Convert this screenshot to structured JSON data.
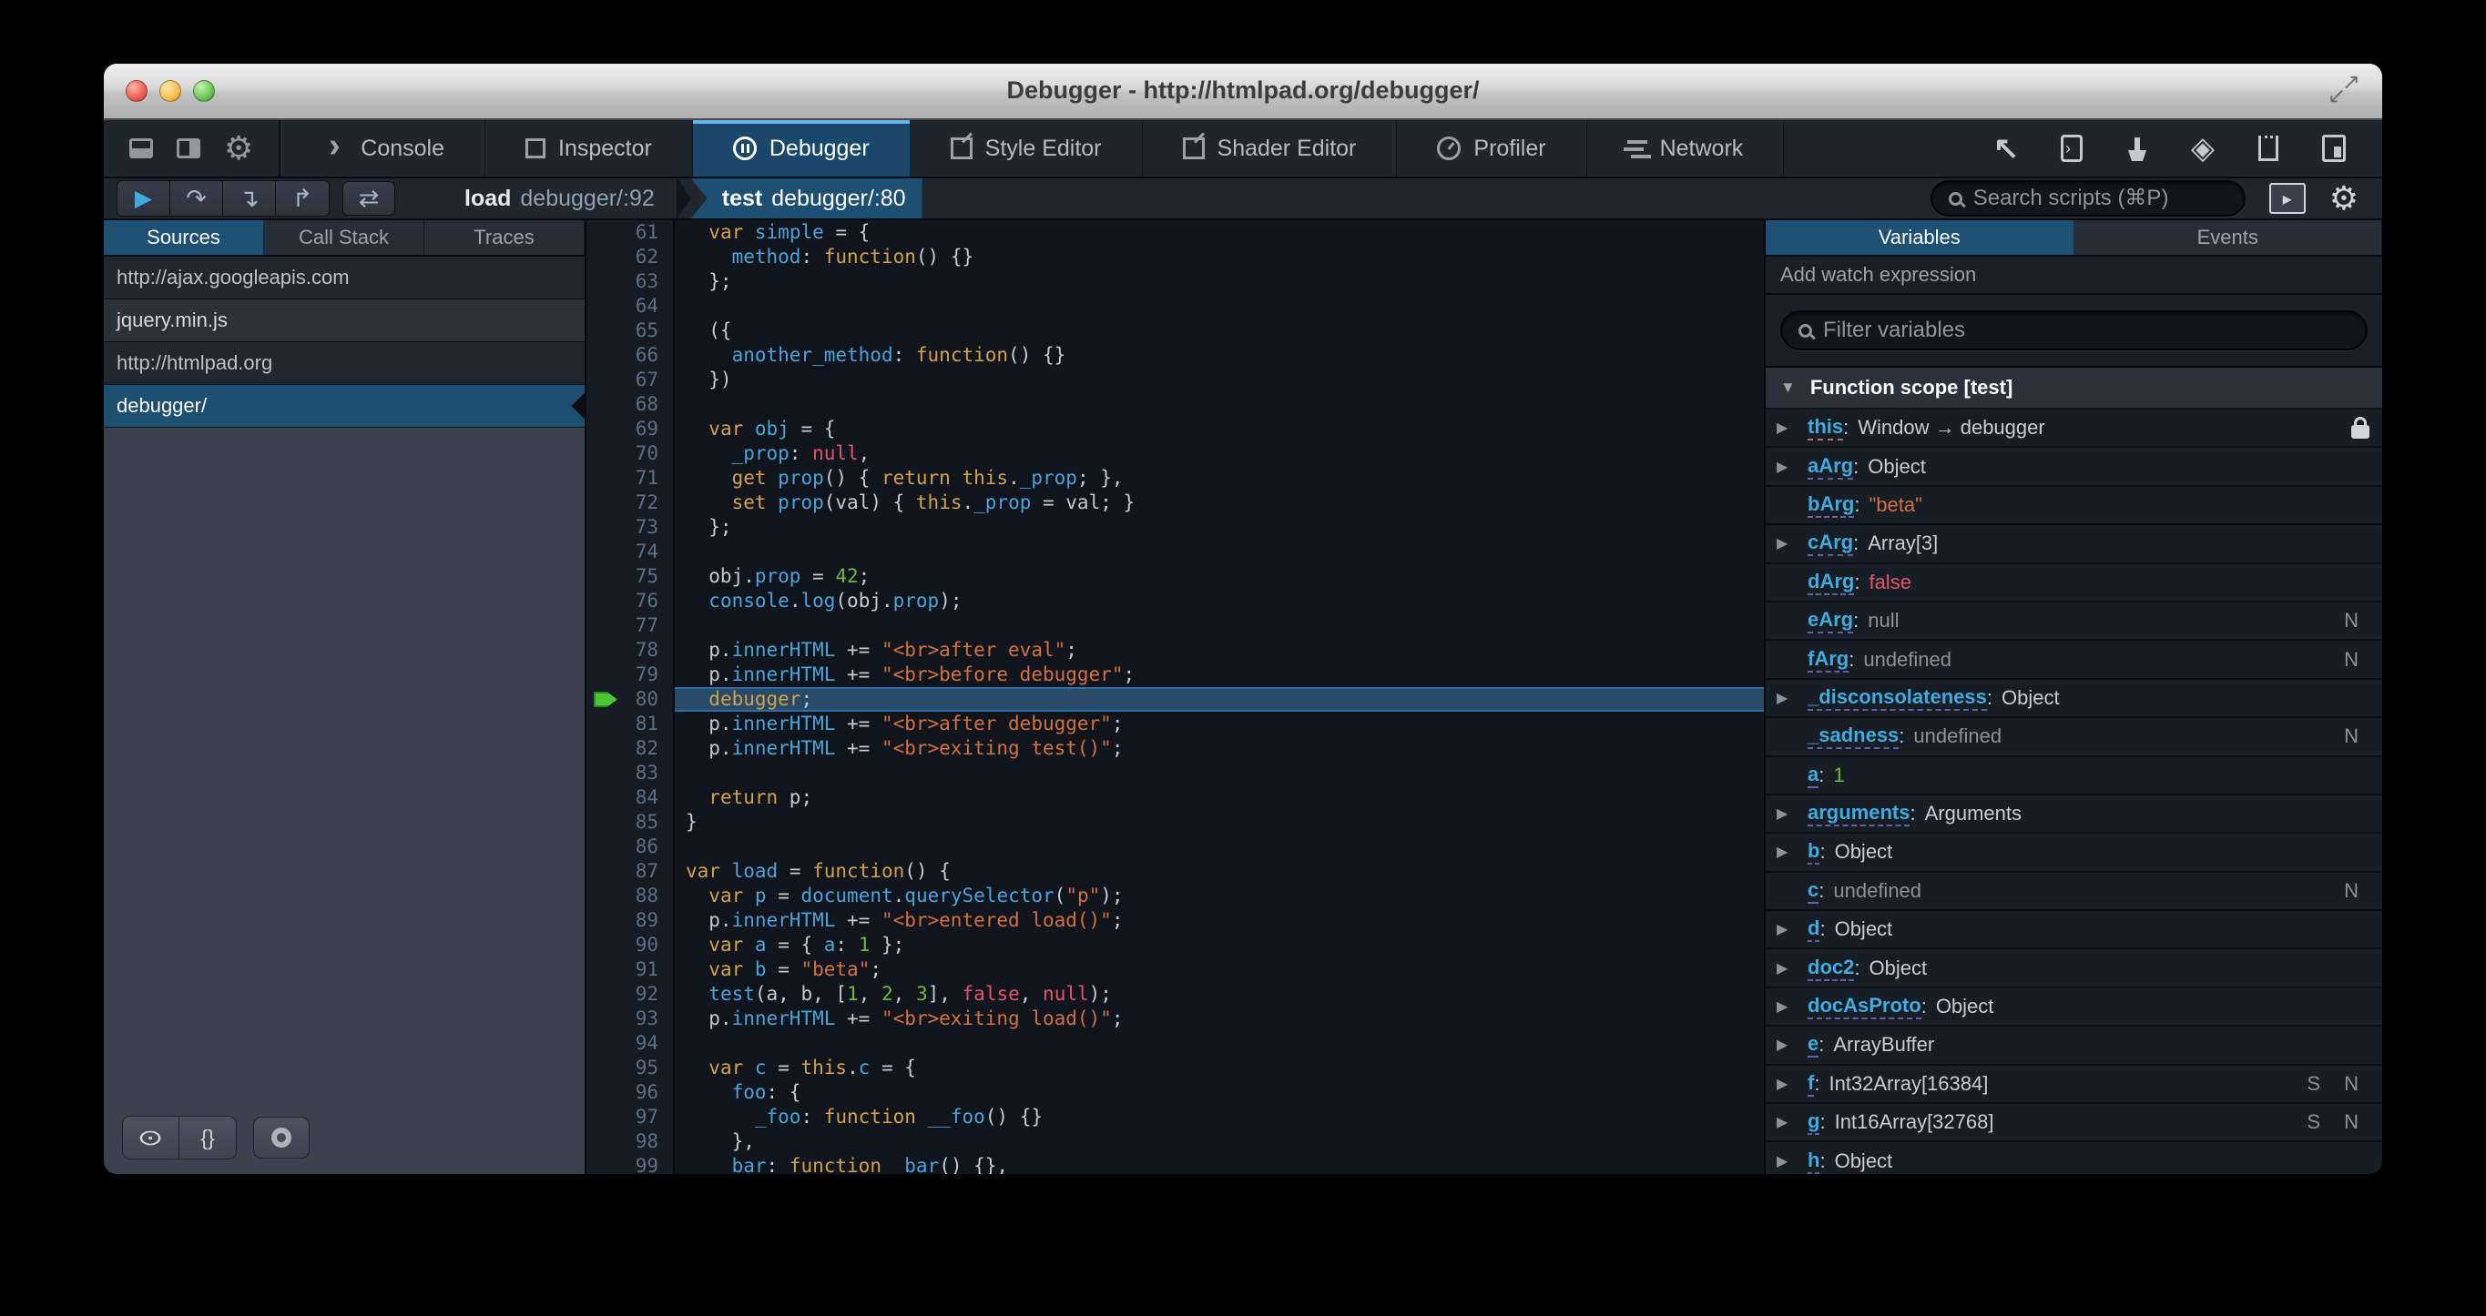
{
  "window": {
    "title": "Debugger - http://htmlpad.org/debugger/"
  },
  "accent_colors": {
    "selection_blue": "#1d4f73",
    "keyword": "#d2a14a",
    "identifier": "#4aa3d9",
    "string": "#d4703c",
    "number": "#6bba3e",
    "atom_red": "#e5546a",
    "resume_blue": "#41a8e0",
    "breakpoint_arrow_green": "#4cc636"
  },
  "toolbar": {
    "left_buttons": [
      "dock-bottom-icon",
      "dock-side-icon",
      "settings-gear-icon"
    ],
    "tabs": [
      {
        "label": "Console",
        "icon": "console-icon",
        "active": false
      },
      {
        "label": "Inspector",
        "icon": "inspector-icon",
        "active": false
      },
      {
        "label": "Debugger",
        "icon": "debugger-icon",
        "active": true
      },
      {
        "label": "Style Editor",
        "icon": "style-editor-icon",
        "active": false
      },
      {
        "label": "Shader Editor",
        "icon": "shader-editor-icon",
        "active": false
      },
      {
        "label": "Profiler",
        "icon": "profiler-icon",
        "active": false
      },
      {
        "label": "Network",
        "icon": "network-icon",
        "active": false
      }
    ],
    "right_buttons": [
      "pick-element-icon",
      "split-console-icon",
      "paintbrush-icon",
      "tilt-3d-icon",
      "scratchpad-icon",
      "responsive-mode-icon"
    ]
  },
  "debugger_toolbar": {
    "controls": [
      {
        "name": "resume-button",
        "glyph": "▶",
        "style": "play"
      },
      {
        "name": "step-over-button",
        "glyph": "↷",
        "style": ""
      },
      {
        "name": "step-in-button",
        "glyph": "↴",
        "style": ""
      },
      {
        "name": "step-out-button",
        "glyph": "↱",
        "style": ""
      }
    ],
    "blackbox_button": {
      "name": "blackbox-toggle-button",
      "glyph": "⇄"
    },
    "breadcrumbs": [
      {
        "fn": "load",
        "loc": "debugger/:92",
        "active": false
      },
      {
        "fn": "test",
        "loc": "debugger/:80",
        "active": true
      }
    ],
    "search_placeholder": "Search scripts (⌘P)"
  },
  "sidebar": {
    "tabs": [
      {
        "label": "Sources",
        "active": true
      },
      {
        "label": "Call Stack",
        "active": false
      },
      {
        "label": "Traces",
        "active": false
      }
    ],
    "sources": [
      {
        "label": "http://ajax.googleapis.com",
        "kind": "group",
        "selected": false
      },
      {
        "label": "jquery.min.js",
        "kind": "file",
        "selected": false
      },
      {
        "label": "http://htmlpad.org",
        "kind": "group",
        "selected": false
      },
      {
        "label": "debugger/",
        "kind": "file",
        "selected": true
      }
    ],
    "footer_buttons": [
      "blackbox-eye-icon",
      "prettyprint-braces-icon",
      "toggle-breakpoints-icon"
    ],
    "prettyprint_label": "{}"
  },
  "editor": {
    "current_line": 80,
    "lines": [
      {
        "n": 61,
        "t": [
          [
            "p",
            "  "
          ],
          [
            "k",
            "var"
          ],
          [
            "p",
            " "
          ],
          [
            "v",
            "simple"
          ],
          [
            "p",
            " = {"
          ]
        ]
      },
      {
        "n": 62,
        "t": [
          [
            "p",
            "    "
          ],
          [
            "v",
            "method"
          ],
          [
            "p",
            ": "
          ],
          [
            "k",
            "function"
          ],
          [
            "p",
            "() {}"
          ]
        ]
      },
      {
        "n": 63,
        "t": [
          [
            "p",
            "  };"
          ]
        ]
      },
      {
        "n": 64,
        "t": []
      },
      {
        "n": 65,
        "t": [
          [
            "p",
            "  ({"
          ]
        ]
      },
      {
        "n": 66,
        "t": [
          [
            "p",
            "    "
          ],
          [
            "v",
            "another_method"
          ],
          [
            "p",
            ": "
          ],
          [
            "k",
            "function"
          ],
          [
            "p",
            "() {}"
          ]
        ]
      },
      {
        "n": 67,
        "t": [
          [
            "p",
            "  })"
          ]
        ]
      },
      {
        "n": 68,
        "t": []
      },
      {
        "n": 69,
        "t": [
          [
            "p",
            "  "
          ],
          [
            "k",
            "var"
          ],
          [
            "p",
            " "
          ],
          [
            "v",
            "obj"
          ],
          [
            "p",
            " = {"
          ]
        ]
      },
      {
        "n": 70,
        "t": [
          [
            "p",
            "    "
          ],
          [
            "v",
            "_prop"
          ],
          [
            "p",
            ": "
          ],
          [
            "x",
            "null"
          ],
          [
            "p",
            ","
          ]
        ]
      },
      {
        "n": 71,
        "t": [
          [
            "p",
            "    "
          ],
          [
            "k",
            "get"
          ],
          [
            "p",
            " "
          ],
          [
            "v",
            "prop"
          ],
          [
            "p",
            "() { "
          ],
          [
            "k",
            "return"
          ],
          [
            "p",
            " "
          ],
          [
            "k",
            "this"
          ],
          [
            "p",
            "."
          ],
          [
            "v",
            "_prop"
          ],
          [
            "p",
            "; },"
          ]
        ]
      },
      {
        "n": 72,
        "t": [
          [
            "p",
            "    "
          ],
          [
            "k",
            "set"
          ],
          [
            "p",
            " "
          ],
          [
            "v",
            "prop"
          ],
          [
            "p",
            "(val) { "
          ],
          [
            "k",
            "this"
          ],
          [
            "p",
            "."
          ],
          [
            "v",
            "_prop"
          ],
          [
            "p",
            " = val; }"
          ]
        ]
      },
      {
        "n": 73,
        "t": [
          [
            "p",
            "  };"
          ]
        ]
      },
      {
        "n": 74,
        "t": []
      },
      {
        "n": 75,
        "t": [
          [
            "p",
            "  obj."
          ],
          [
            "v",
            "prop"
          ],
          [
            "p",
            " = "
          ],
          [
            "n",
            "42"
          ],
          [
            "p",
            ";"
          ]
        ]
      },
      {
        "n": 76,
        "t": [
          [
            "p",
            "  "
          ],
          [
            "v",
            "console"
          ],
          [
            "p",
            "."
          ],
          [
            "v",
            "log"
          ],
          [
            "p",
            "(obj."
          ],
          [
            "v",
            "prop"
          ],
          [
            "p",
            ");"
          ]
        ]
      },
      {
        "n": 77,
        "t": []
      },
      {
        "n": 78,
        "t": [
          [
            "p",
            "  p."
          ],
          [
            "v",
            "innerHTML"
          ],
          [
            "p",
            " += "
          ],
          [
            "s",
            "\"<br>after eval\""
          ],
          [
            "p",
            ";"
          ]
        ]
      },
      {
        "n": 79,
        "t": [
          [
            "p",
            "  p."
          ],
          [
            "v",
            "innerHTML"
          ],
          [
            "p",
            " += "
          ],
          [
            "s",
            "\"<br>before debugger\""
          ],
          [
            "p",
            ";"
          ]
        ]
      },
      {
        "n": 80,
        "t": [
          [
            "p",
            "  "
          ],
          [
            "k",
            "debugger"
          ],
          [
            "p",
            ";"
          ]
        ]
      },
      {
        "n": 81,
        "t": [
          [
            "p",
            "  p."
          ],
          [
            "v",
            "innerHTML"
          ],
          [
            "p",
            " += "
          ],
          [
            "s",
            "\"<br>after debugger\""
          ],
          [
            "p",
            ";"
          ]
        ]
      },
      {
        "n": 82,
        "t": [
          [
            "p",
            "  p."
          ],
          [
            "v",
            "innerHTML"
          ],
          [
            "p",
            " += "
          ],
          [
            "s",
            "\"<br>exiting test()\""
          ],
          [
            "p",
            ";"
          ]
        ]
      },
      {
        "n": 83,
        "t": []
      },
      {
        "n": 84,
        "t": [
          [
            "p",
            "  "
          ],
          [
            "k",
            "return"
          ],
          [
            "p",
            " p;"
          ]
        ]
      },
      {
        "n": 85,
        "t": [
          [
            "p",
            "}"
          ]
        ]
      },
      {
        "n": 86,
        "t": []
      },
      {
        "n": 87,
        "t": [
          [
            "k",
            "var"
          ],
          [
            "p",
            " "
          ],
          [
            "v",
            "load"
          ],
          [
            "p",
            " = "
          ],
          [
            "k",
            "function"
          ],
          [
            "p",
            "() {"
          ]
        ]
      },
      {
        "n": 88,
        "t": [
          [
            "p",
            "  "
          ],
          [
            "k",
            "var"
          ],
          [
            "p",
            " "
          ],
          [
            "v",
            "p"
          ],
          [
            "p",
            " = "
          ],
          [
            "v",
            "document"
          ],
          [
            "p",
            "."
          ],
          [
            "v",
            "querySelector"
          ],
          [
            "p",
            "("
          ],
          [
            "s",
            "\"p\""
          ],
          [
            "p",
            ");"
          ]
        ]
      },
      {
        "n": 89,
        "t": [
          [
            "p",
            "  p."
          ],
          [
            "v",
            "innerHTML"
          ],
          [
            "p",
            " += "
          ],
          [
            "s",
            "\"<br>entered load()\""
          ],
          [
            "p",
            ";"
          ]
        ]
      },
      {
        "n": 90,
        "t": [
          [
            "p",
            "  "
          ],
          [
            "k",
            "var"
          ],
          [
            "p",
            " "
          ],
          [
            "v",
            "a"
          ],
          [
            "p",
            " = { "
          ],
          [
            "v",
            "a"
          ],
          [
            "p",
            ": "
          ],
          [
            "n",
            "1"
          ],
          [
            "p",
            " };"
          ]
        ]
      },
      {
        "n": 91,
        "t": [
          [
            "p",
            "  "
          ],
          [
            "k",
            "var"
          ],
          [
            "p",
            " "
          ],
          [
            "v",
            "b"
          ],
          [
            "p",
            " = "
          ],
          [
            "s",
            "\"beta\""
          ],
          [
            "p",
            ";"
          ]
        ]
      },
      {
        "n": 92,
        "t": [
          [
            "p",
            "  "
          ],
          [
            "v",
            "test"
          ],
          [
            "p",
            "(a, b, ["
          ],
          [
            "n",
            "1"
          ],
          [
            "p",
            ", "
          ],
          [
            "n",
            "2"
          ],
          [
            "p",
            ", "
          ],
          [
            "n",
            "3"
          ],
          [
            "p",
            "], "
          ],
          [
            "x",
            "false"
          ],
          [
            "p",
            ", "
          ],
          [
            "x",
            "null"
          ],
          [
            "p",
            ");"
          ]
        ]
      },
      {
        "n": 93,
        "t": [
          [
            "p",
            "  p."
          ],
          [
            "v",
            "innerHTML"
          ],
          [
            "p",
            " += "
          ],
          [
            "s",
            "\"<br>exiting load()\""
          ],
          [
            "p",
            ";"
          ]
        ]
      },
      {
        "n": 94,
        "t": []
      },
      {
        "n": 95,
        "t": [
          [
            "p",
            "  "
          ],
          [
            "k",
            "var"
          ],
          [
            "p",
            " "
          ],
          [
            "v",
            "c"
          ],
          [
            "p",
            " = "
          ],
          [
            "k",
            "this"
          ],
          [
            "p",
            "."
          ],
          [
            "v",
            "c"
          ],
          [
            "p",
            " = {"
          ]
        ]
      },
      {
        "n": 96,
        "t": [
          [
            "p",
            "    "
          ],
          [
            "v",
            "foo"
          ],
          [
            "p",
            ": {"
          ]
        ]
      },
      {
        "n": 97,
        "t": [
          [
            "p",
            "      "
          ],
          [
            "v",
            "_foo"
          ],
          [
            "p",
            ": "
          ],
          [
            "k",
            "function"
          ],
          [
            "p",
            " "
          ],
          [
            "v",
            "__foo"
          ],
          [
            "p",
            "() {}"
          ]
        ]
      },
      {
        "n": 98,
        "t": [
          [
            "p",
            "    },"
          ]
        ]
      },
      {
        "n": 99,
        "t": [
          [
            "p",
            "    "
          ],
          [
            "v",
            "bar"
          ],
          [
            "p",
            ": "
          ],
          [
            "k",
            "function"
          ],
          [
            "p",
            " "
          ],
          [
            "v",
            "_bar"
          ],
          [
            "p",
            "() {},"
          ]
        ]
      }
    ]
  },
  "variables": {
    "tabs": [
      {
        "label": "Variables",
        "active": true
      },
      {
        "label": "Events",
        "active": false
      }
    ],
    "watch_label": "Add watch expression",
    "filter_placeholder": "Filter variables",
    "scope_label": "Function scope [test]",
    "rows": [
      {
        "name": "this",
        "value": "Window → debugger",
        "vclass": "obj",
        "exp": true,
        "lock": true,
        "underline": "pink",
        "badges": ""
      },
      {
        "name": "aArg",
        "value": "Object",
        "vclass": "obj",
        "exp": true,
        "badges": ""
      },
      {
        "name": "bArg",
        "value": "\"beta\"",
        "vclass": "str",
        "exp": false,
        "badges": ""
      },
      {
        "name": "cArg",
        "value": "Array[3]",
        "vclass": "obj",
        "exp": true,
        "badges": ""
      },
      {
        "name": "dArg",
        "value": "false",
        "vclass": "bool",
        "exp": false,
        "badges": ""
      },
      {
        "name": "eArg",
        "value": "null",
        "vclass": "nul",
        "exp": false,
        "badges": "N"
      },
      {
        "name": "fArg",
        "value": "undefined",
        "vclass": "nul",
        "exp": false,
        "badges": "N"
      },
      {
        "name": "_disconsolateness",
        "value": "Object",
        "vclass": "obj",
        "exp": true,
        "badges": ""
      },
      {
        "name": "_sadness",
        "value": "undefined",
        "vclass": "nul",
        "exp": false,
        "badges": "N"
      },
      {
        "name": "a",
        "value": "1",
        "vclass": "num",
        "exp": false,
        "badges": ""
      },
      {
        "name": "arguments",
        "value": "Arguments",
        "vclass": "obj",
        "exp": true,
        "badges": ""
      },
      {
        "name": "b",
        "value": "Object",
        "vclass": "obj",
        "exp": true,
        "badges": ""
      },
      {
        "name": "c",
        "value": "undefined",
        "vclass": "nul",
        "exp": false,
        "badges": "N"
      },
      {
        "name": "d",
        "value": "Object",
        "vclass": "obj",
        "exp": true,
        "badges": ""
      },
      {
        "name": "doc2",
        "value": "Object",
        "vclass": "obj",
        "exp": true,
        "badges": ""
      },
      {
        "name": "docAsProto",
        "value": "Object",
        "vclass": "obj",
        "exp": true,
        "badges": ""
      },
      {
        "name": "e",
        "value": "ArrayBuffer",
        "vclass": "obj",
        "exp": true,
        "badges": ""
      },
      {
        "name": "f",
        "value": "Int32Array[16384]",
        "vclass": "obj",
        "exp": true,
        "badges": "S N"
      },
      {
        "name": "g",
        "value": "Int16Array[32768]",
        "vclass": "obj",
        "exp": true,
        "badges": "S N"
      },
      {
        "name": "h",
        "value": "Object",
        "vclass": "obj",
        "exp": true,
        "badges": ""
      }
    ]
  }
}
